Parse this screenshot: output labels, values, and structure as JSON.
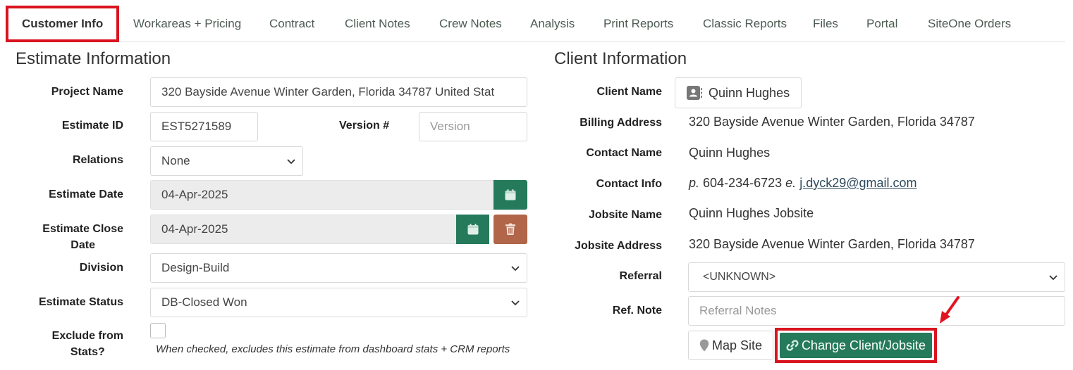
{
  "tabs": [
    {
      "label": "Customer Info",
      "active": true
    },
    {
      "label": "Workareas + Pricing"
    },
    {
      "label": "Contract"
    },
    {
      "label": "Client Notes"
    },
    {
      "label": "Crew Notes"
    },
    {
      "label": "Analysis"
    },
    {
      "label": "Print Reports"
    },
    {
      "label": "Classic Reports"
    },
    {
      "label": "Files"
    },
    {
      "label": "Portal"
    },
    {
      "label": "SiteOne Orders"
    }
  ],
  "estimate": {
    "heading": "Estimate Information",
    "project_name_label": "Project Name",
    "project_name_value": "320 Bayside Avenue Winter Garden, Florida 34787 United Stat",
    "estimate_id_label": "Estimate ID",
    "estimate_id_value": "EST5271589",
    "version_label": "Version #",
    "version_placeholder": "Version",
    "relations_label": "Relations",
    "relations_value": "None",
    "estimate_date_label": "Estimate Date",
    "estimate_date_value": "04-Apr-2025",
    "close_date_label_1": "Estimate Close",
    "close_date_label_2": "Date",
    "close_date_value": "04-Apr-2025",
    "division_label": "Division",
    "division_value": "Design-Build",
    "status_label": "Estimate Status",
    "status_value": "DB-Closed Won",
    "exclude_label_1": "Exclude from",
    "exclude_label_2": "Stats?",
    "exclude_checked": false,
    "exclude_hint": "When checked, excludes this estimate from dashboard stats + CRM reports"
  },
  "client": {
    "heading": "Client Information",
    "client_name_label": "Client Name",
    "client_name_value": "Quinn Hughes",
    "billing_label": "Billing Address",
    "billing_value": "320 Bayside Avenue Winter Garden, Florida 34787",
    "contact_name_label": "Contact Name",
    "contact_name_value": "Quinn Hughes",
    "contact_info_label": "Contact Info",
    "phone_prefix": "p.",
    "phone_value": "604-234-6723",
    "email_prefix": "e.",
    "email_value": "j.dyck29@gmail.com",
    "jobsite_name_label": "Jobsite Name",
    "jobsite_name_value": "Quinn Hughes Jobsite",
    "jobsite_address_label": "Jobsite Address",
    "jobsite_address_value": "320 Bayside Avenue Winter Garden, Florida 34787",
    "referral_label": "Referral",
    "referral_value": "<UNKNOWN>",
    "ref_note_label": "Ref. Note",
    "ref_note_placeholder": "Referral Notes",
    "map_site_label": "Map Site",
    "change_label": "Change Client/Jobsite"
  },
  "icons": {
    "calendar": "calendar-icon",
    "trash": "trash-icon",
    "contact_card": "contact-card-icon",
    "map_pin": "map-pin-icon",
    "link": "link-icon",
    "annotation_arrow": "arrow-icon"
  },
  "colors": {
    "accent_green": "#247a5b",
    "danger_rust": "#b16549",
    "highlight_red": "#d9141f"
  }
}
